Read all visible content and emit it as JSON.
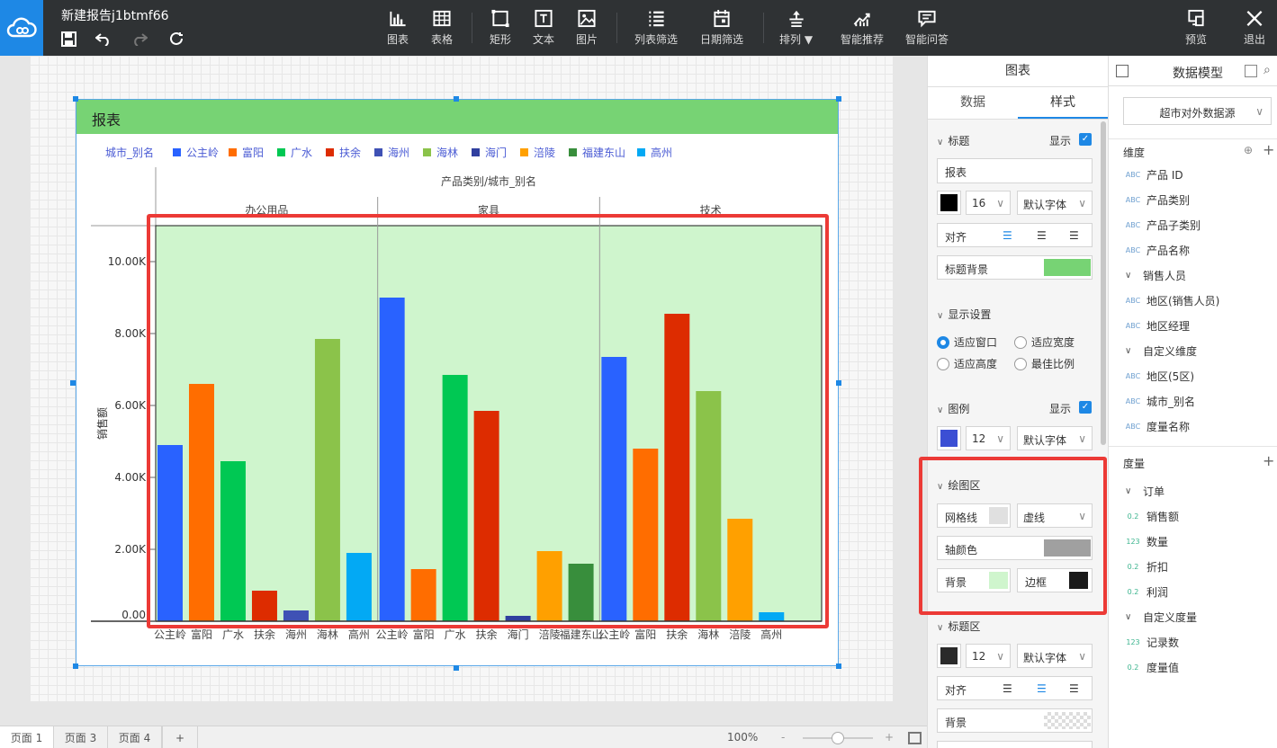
{
  "app": {
    "doc_title": "新建报告j1btmf66"
  },
  "toolbar": {
    "items": [
      {
        "label": "图表"
      },
      {
        "label": "表格"
      },
      {
        "label": "矩形"
      },
      {
        "label": "文本"
      },
      {
        "label": "图片"
      },
      {
        "label": "列表筛选"
      },
      {
        "label": "日期筛选"
      },
      {
        "label": "排列"
      },
      {
        "label": "智能推荐"
      },
      {
        "label": "智能问答"
      },
      {
        "label": "预览"
      },
      {
        "label": "退出"
      }
    ]
  },
  "report": {
    "title": "报表",
    "legend_title": "城市_别名",
    "column_header": "产品类别/城市_别名",
    "y_axis_label": "销售额"
  },
  "chart_data": {
    "type": "bar",
    "ylim": [
      0,
      11000
    ],
    "yticks": [
      "0.00",
      "2.00K",
      "4.00K",
      "6.00K",
      "8.00K",
      "10.00K"
    ],
    "ytick_values": [
      0,
      2000,
      4000,
      6000,
      8000,
      10000
    ],
    "grid": true,
    "legend_position": "top-left",
    "series_colors": {
      "公主岭": "#2962ff",
      "富阳": "#ff6d00",
      "广水": "#00c853",
      "扶余": "#dd2c00",
      "海州": "#3f51b5",
      "海林": "#8bc34a",
      "海门": "#303f9f",
      "涪陵": "#ffa000",
      "福建东山": "#388e3c",
      "高州": "#03a9f4"
    },
    "legend": [
      "公主岭",
      "富阳",
      "广水",
      "扶余",
      "海州",
      "海林",
      "海门",
      "涪陵",
      "福建东山",
      "高州"
    ],
    "groups": [
      {
        "name": "办公用品",
        "cities": [
          "公主岭",
          "富阳",
          "广水",
          "扶余",
          "海州",
          "海林",
          "高州"
        ],
        "values": [
          4900,
          6600,
          4450,
          850,
          300,
          7850,
          1900
        ]
      },
      {
        "name": "家具",
        "cities": [
          "公主岭",
          "富阳",
          "广水",
          "扶余",
          "海门",
          "涪陵",
          "福建东山"
        ],
        "values": [
          9000,
          1450,
          6850,
          5850,
          150,
          1950,
          1600
        ]
      },
      {
        "name": "技术",
        "cities": [
          "公主岭",
          "富阳",
          "扶余",
          "海林",
          "涪陵",
          "高州"
        ],
        "values": [
          7350,
          4800,
          8550,
          6400,
          2850,
          250
        ]
      }
    ]
  },
  "bottom": {
    "tabs": [
      "页面 1",
      "页面 3",
      "页面 4",
      "+"
    ],
    "zoom": "100%",
    "zoom_level": 0.5
  },
  "style_panel": {
    "header": "图表",
    "tabs": [
      "数据",
      "样式"
    ],
    "title_section": {
      "label": "标题",
      "show_label": "显示",
      "title_value": "报表",
      "font_size": "16",
      "font": "默认字体",
      "align_label": "对齐",
      "bg_label": "标题背景",
      "color": "#000000",
      "bg_color": "#77d374"
    },
    "display_section": {
      "label": "显示设置",
      "options": [
        "适应窗口",
        "适应宽度",
        "适应高度",
        "最佳比例"
      ]
    },
    "legend_section": {
      "label": "图例",
      "show_label": "显示",
      "font_size": "12",
      "font": "默认字体",
      "color": "#3b4fd4"
    },
    "plot_section": {
      "label": "绘图区",
      "grid_label": "网格线",
      "grid_style": "虚线",
      "axis_color_label": "轴颜色",
      "bg_label": "背景",
      "border_label": "边框",
      "grid_color": "#e0e0e0",
      "axis_color": "#a0a0a0",
      "bg_color": "#cff5cd",
      "border_color": "#1a1a1a"
    },
    "label_section": {
      "label": "标题区",
      "font_size": "12",
      "font": "默认字体",
      "align_label": "对齐",
      "bg_label": "背景",
      "color": "#2a2a2a"
    }
  },
  "model_panel": {
    "header": "数据模型",
    "source": "超市对外数据源",
    "dim_title": "维度",
    "dims": [
      {
        "tag": "ABC",
        "label": "产品 ID"
      },
      {
        "tag": "ABC",
        "label": "产品类别"
      },
      {
        "tag": "ABC",
        "label": "产品子类别"
      },
      {
        "tag": "ABC",
        "label": "产品名称"
      },
      {
        "tag": "group",
        "label": "销售人员"
      },
      {
        "tag": "ABC",
        "label": "地区(销售人员)"
      },
      {
        "tag": "ABC",
        "label": "地区经理"
      },
      {
        "tag": "group",
        "label": "自定义维度"
      },
      {
        "tag": "ABC",
        "label": "地区(5区)"
      },
      {
        "tag": "ABC",
        "label": "城市_别名"
      },
      {
        "tag": "ABC",
        "label": "度量名称"
      }
    ],
    "measure_title": "度量",
    "measures": [
      {
        "tag": "group",
        "label": "订单"
      },
      {
        "tag": "0.2",
        "label": "销售额"
      },
      {
        "tag": "123",
        "label": "数量"
      },
      {
        "tag": "0.2",
        "label": "折扣"
      },
      {
        "tag": "0.2",
        "label": "利润"
      },
      {
        "tag": "group",
        "label": "自定义度量"
      },
      {
        "tag": "123",
        "label": "记录数"
      },
      {
        "tag": "0.2",
        "label": "度量值"
      }
    ]
  }
}
